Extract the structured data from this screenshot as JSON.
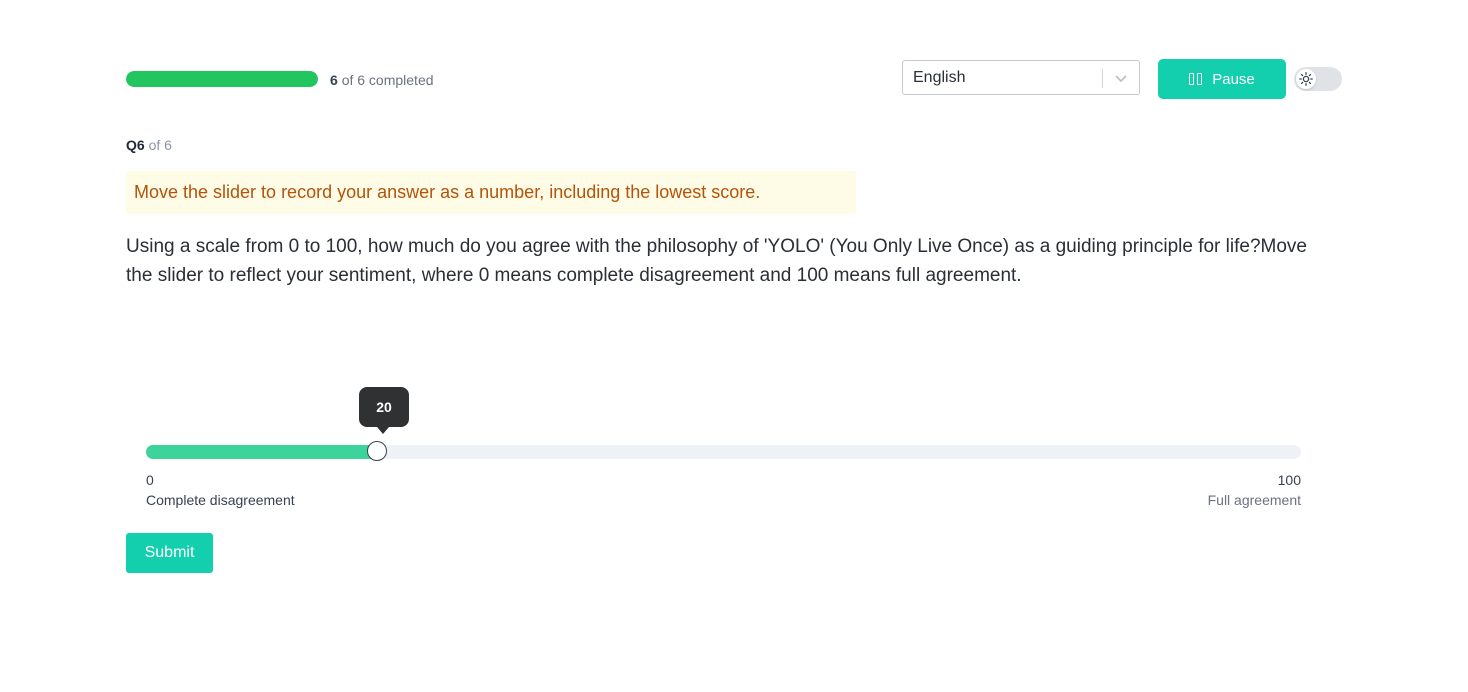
{
  "progress": {
    "current": "6",
    "rest": "of 6 completed",
    "fraction": 1.0,
    "color": "#22c55e"
  },
  "language": {
    "selected": "English"
  },
  "pause": {
    "label": "Pause",
    "color": "#14cfae"
  },
  "theme_toggle": {
    "icon": "sun-icon",
    "state": "off"
  },
  "question": {
    "number": "Q6",
    "of": "of 6",
    "hint": "Move the slider to record your answer as a number, including the lowest score.",
    "text": "Using a scale from 0 to 100, how much do you agree with the philosophy of 'YOLO' (You Only Live Once) as a guiding principle for life?Move the slider to reflect your sentiment, where 0 means complete disagreement and 100 means full agreement."
  },
  "slider": {
    "min": 0,
    "max": 100,
    "value": 20,
    "value_label": "20",
    "min_label": "0",
    "max_label": "100",
    "min_text": "Complete disagreement",
    "max_text": "Full agreement",
    "fill_color": "#3dd49c"
  },
  "submit": {
    "label": "Submit"
  }
}
